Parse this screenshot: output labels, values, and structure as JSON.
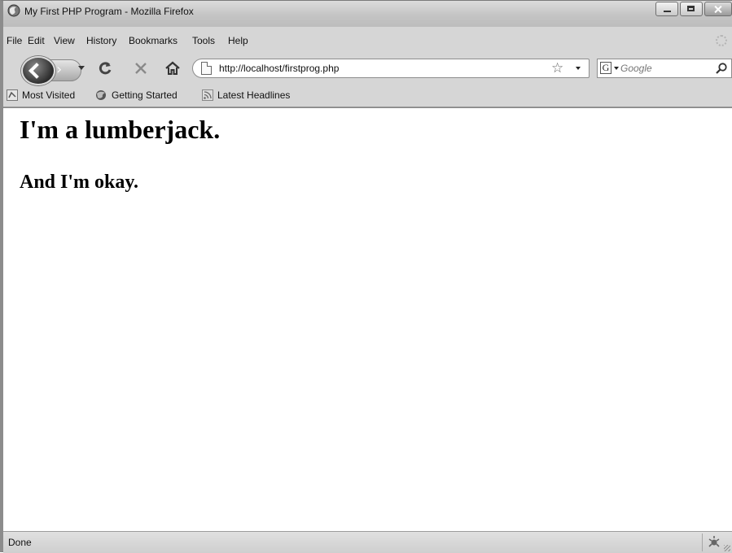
{
  "window": {
    "title": "My First PHP Program - Mozilla Firefox"
  },
  "menu": {
    "items": [
      "File",
      "Edit",
      "View",
      "History",
      "Bookmarks",
      "Tools",
      "Help"
    ]
  },
  "toolbar": {
    "url": "http://localhost/firstprog.php",
    "search_placeholder": "Google",
    "icons": [
      "back-icon",
      "forward-icon",
      "reload-icon",
      "stop-icon",
      "home-icon",
      "page-icon",
      "star-icon",
      "google-icon",
      "magnifier-icon"
    ]
  },
  "bookmarks": {
    "items": [
      {
        "label": "Most Visited",
        "icon": "most-visited-icon"
      },
      {
        "label": "Getting Started",
        "icon": "getting-started-icon"
      },
      {
        "label": "Latest Headlines",
        "icon": "rss-icon"
      }
    ]
  },
  "page": {
    "heading1": "I'm a lumberjack.",
    "heading2": "And I'm okay."
  },
  "status": {
    "text": "Done"
  }
}
